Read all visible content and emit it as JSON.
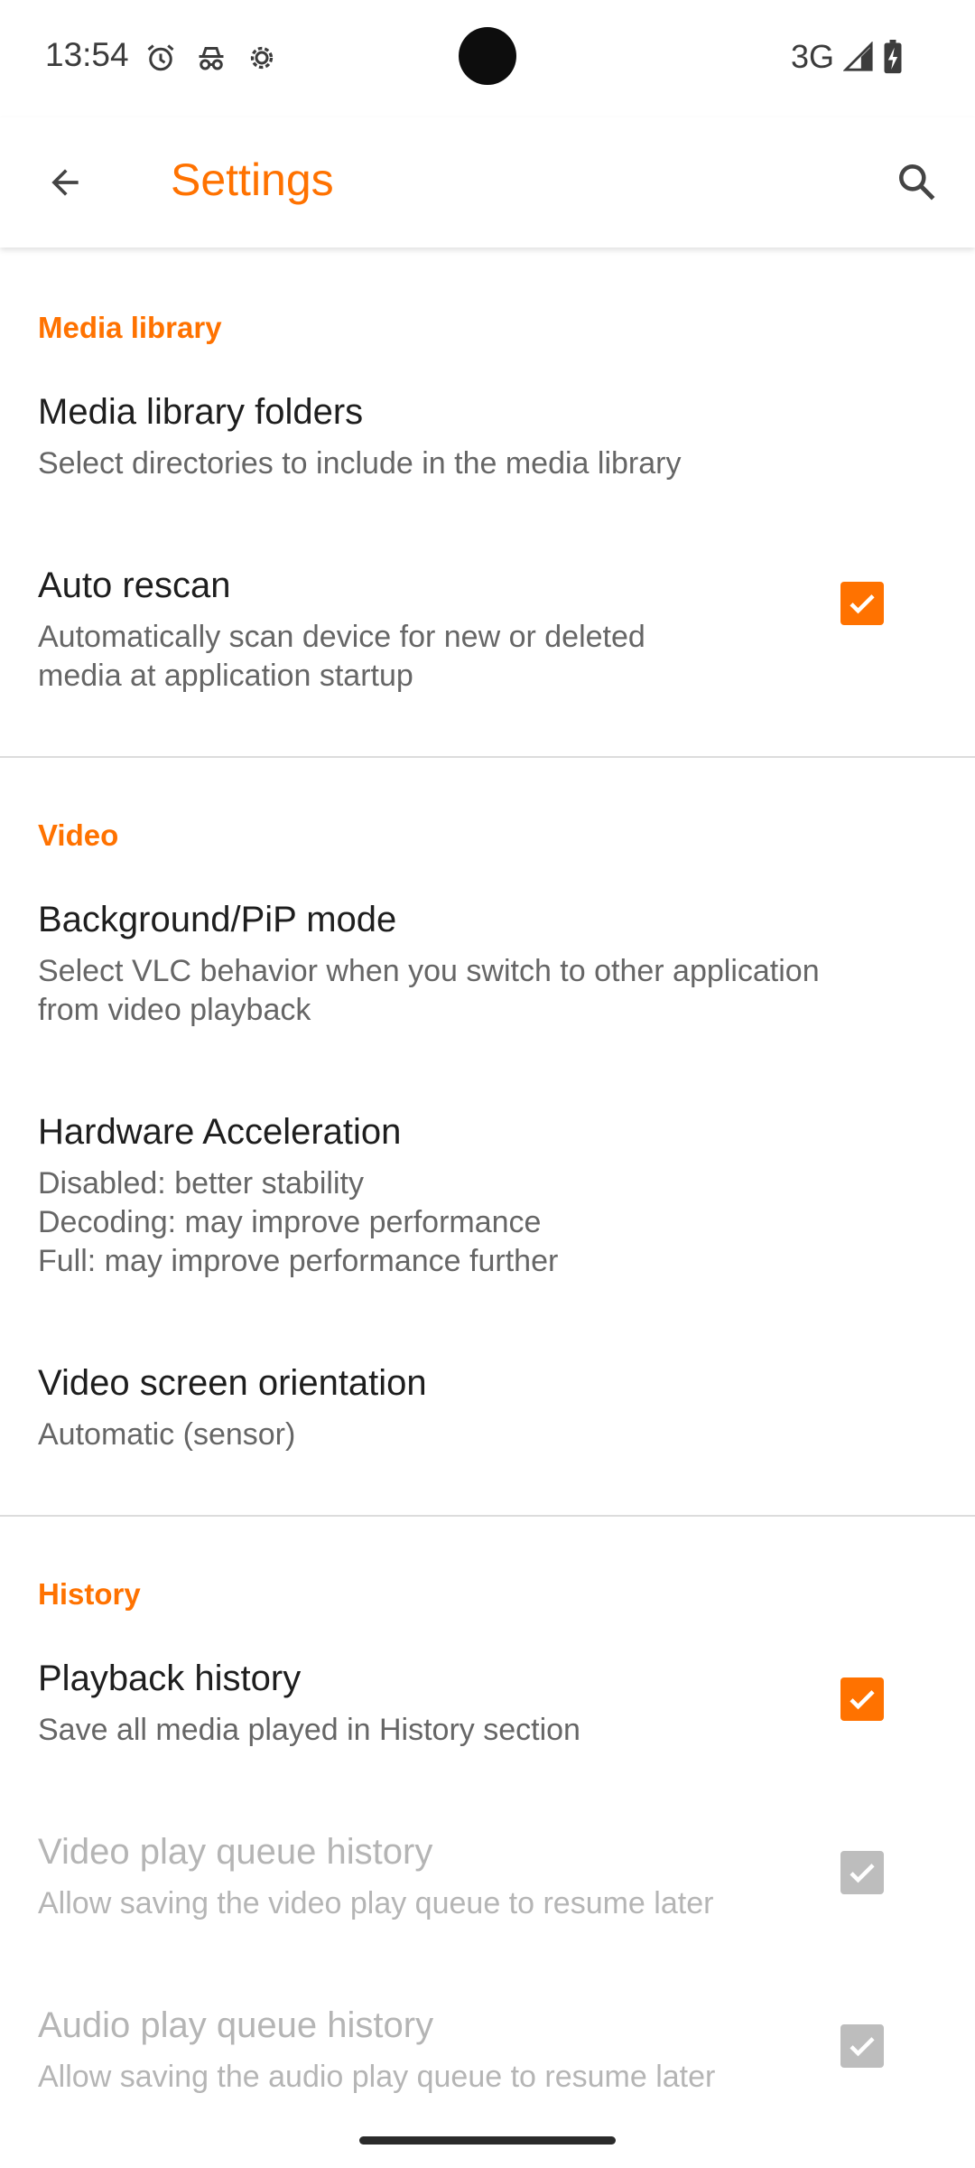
{
  "status_bar": {
    "time": "13:54",
    "left_icons": [
      "alarm-icon",
      "incognito-icon",
      "settings-gear-icon"
    ],
    "network": "3G",
    "right_icons": [
      "signal-icon",
      "battery-charging-icon"
    ]
  },
  "app_bar": {
    "title": "Settings",
    "back_icon": "arrow-back-icon",
    "search_icon": "search-icon"
  },
  "colors": {
    "accent": "#ff7200",
    "title_text": "#1e1e1e",
    "summary_text": "#666666",
    "disabled_text": "#b5b5b5",
    "disabled_checkbox": "#bdbdbd"
  },
  "sections": {
    "media_library": {
      "header": "Media library",
      "folders": {
        "title": "Media library folders",
        "summary": "Select directories to include in the media library"
      },
      "auto_rescan": {
        "title": "Auto rescan",
        "summary": "Automatically scan device for new or deleted\nmedia at application startup",
        "checked": true
      }
    },
    "video": {
      "header": "Video",
      "background_pip": {
        "title": "Background/PiP mode",
        "summary": "Select VLC behavior when you switch to other application\nfrom video playback"
      },
      "hardware_acceleration": {
        "title": "Hardware Acceleration",
        "summary": "Disabled: better stability\nDecoding: may improve performance\nFull: may improve performance further"
      },
      "screen_orientation": {
        "title": "Video screen orientation",
        "summary": "Automatic (sensor)"
      }
    },
    "history": {
      "header": "History",
      "playback_history": {
        "title": "Playback history",
        "summary": "Save all media played in History section",
        "checked": true,
        "enabled": true
      },
      "video_queue_history": {
        "title": "Video play queue history",
        "summary": "Allow saving the video play queue to resume later",
        "checked": true,
        "enabled": false
      },
      "audio_queue_history": {
        "title": "Audio play queue history",
        "summary": "Allow saving the audio play queue to resume later",
        "checked": true,
        "enabled": false
      }
    }
  }
}
